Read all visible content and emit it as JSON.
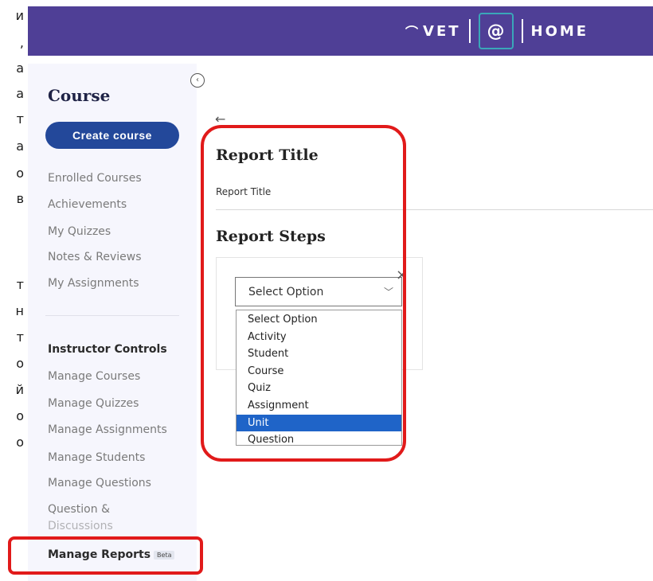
{
  "left_strip": [
    "и",
    ",",
    "а",
    "а",
    "т",
    "а",
    "о",
    "в",
    "т",
    "н",
    "т",
    "о",
    "й",
    "о",
    "о"
  ],
  "header": {
    "logo_left": "VET",
    "logo_at": "@",
    "logo_right": "HOME"
  },
  "sidebar": {
    "title": "Course",
    "create_button": "Create course",
    "items": [
      "Enrolled Courses",
      "Achievements",
      "My Quizzes",
      "Notes & Reviews",
      "My Assignments"
    ],
    "instructor_heading": "Instructor Controls",
    "instructor_items": [
      "Manage Courses",
      "Manage Quizzes",
      "Manage Assignments",
      "Manage Students",
      "Manage Questions",
      "Question &",
      "Discussions"
    ],
    "manage_reports": "Manage Reports",
    "beta_badge": "Beta"
  },
  "main": {
    "back_icon": "←",
    "report_title_heading": "Report Title",
    "report_title_value": "Report Title",
    "report_steps_heading": "Report Steps",
    "remove_icon": "×",
    "select_value": "Select Option",
    "options": [
      "Select Option",
      "Activity",
      "Student",
      "Course",
      "Quiz",
      "Assignment",
      "Unit",
      "Question"
    ],
    "highlighted_option": "Unit"
  },
  "colors": {
    "header_bg": "#4f3f96",
    "primary_button": "#23489a",
    "highlight_option": "#1f64c8",
    "annotation_red": "#e11a1a"
  }
}
